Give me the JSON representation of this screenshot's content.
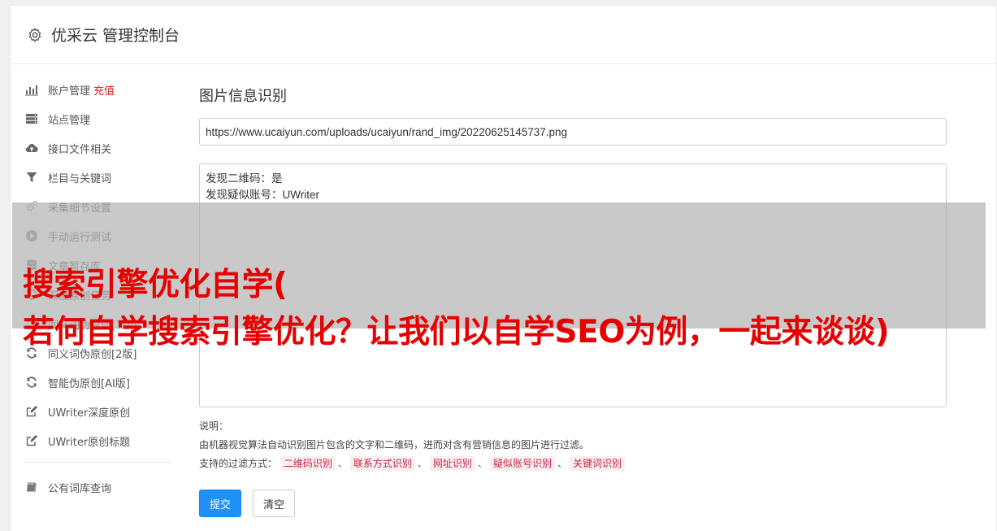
{
  "header": {
    "icon": "gear-icon",
    "title": "优采云 管理控制台"
  },
  "sidebar": {
    "items": [
      {
        "icon": "bar-chart-icon",
        "label": "账户管理",
        "extra": "充值"
      },
      {
        "icon": "server-icon",
        "label": "站点管理"
      },
      {
        "icon": "cloud-upload-icon",
        "label": "接口文件相关"
      },
      {
        "icon": "filter-icon",
        "label": "栏目与关键词"
      },
      {
        "icon": "gears-icon",
        "label": "采集细节设置"
      },
      {
        "icon": "play-circle-icon",
        "label": "手动运行测试"
      },
      {
        "icon": "database-icon",
        "label": "文章暂存库"
      },
      {
        "icon": "refresh-icon",
        "label": "深度原创任务"
      },
      {
        "icon": "refresh-icon",
        "label": "同义词伪原创[1版]"
      },
      {
        "icon": "refresh-icon",
        "label": "同义词伪原创[2版]"
      },
      {
        "icon": "refresh-icon",
        "label": "智能伪原创[AI版]"
      },
      {
        "icon": "edit-icon",
        "label": "UWriter深度原创"
      },
      {
        "icon": "edit-icon",
        "label": "UWriter原创标题"
      }
    ],
    "bottom_items": [
      {
        "icon": "book-icon",
        "label": "公有词库查询"
      }
    ]
  },
  "main": {
    "title": "图片信息识别",
    "url_value": "https://www.ucaiyun.com/uploads/ucaiyun/rand_img/20220625145737.png",
    "result_lines": [
      "发现二维码：是",
      "发现疑似账号：UWriter"
    ],
    "note_label": "说明：",
    "note_desc": "由机器视觉算法自动识别图片包含的文字和二维码，进而对含有营销信息的图片进行过滤。",
    "filter_label": "支持的过滤方式：",
    "filters": [
      "二维码识别",
      "联系方式识别",
      "网址识别",
      "疑似账号识别",
      "关键词识别"
    ],
    "separator": "、",
    "submit_label": "提交",
    "clear_label": "清空"
  },
  "overlay": {
    "line1": "搜索引擎优化自学(",
    "line2": "若何自学搜索引擎优化？让我们以自学SEO为例，一起来谈谈)"
  },
  "colors": {
    "primary": "#1e90f7",
    "recharge": "#e02020",
    "overlay_text": "#e60000",
    "tag_text": "#c7254e"
  }
}
